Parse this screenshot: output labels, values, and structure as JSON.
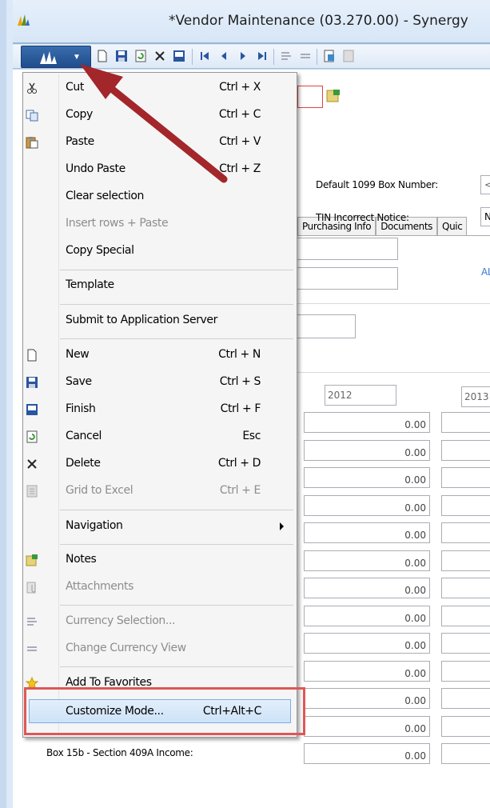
{
  "window": {
    "title": "*Vendor Maintenance (03.270.00) - Synergy"
  },
  "colors": {
    "menu_background": "#f5f5f5",
    "highlight": "#cde2f8",
    "annotation_red": "#de5757",
    "arrow": "#a3262a",
    "app_button": "#1f4c8c"
  },
  "toolbar": {
    "icons": [
      "app-menu-icon",
      "new-icon",
      "save-icon",
      "refresh-icon",
      "delete-icon",
      "finish-icon",
      "first-icon",
      "prev-icon",
      "next-icon",
      "last-icon",
      "currency-icon",
      "currency-view-icon",
      "notes-icon",
      "excel-icon"
    ]
  },
  "tabs": [
    "Purchasing Info",
    "Documents",
    "Quic"
  ],
  "form": {
    "default_1099_label": "Default 1099 Box Number:",
    "default_1099_value": "<N",
    "tin_label": "TIN Incorrect Notice:",
    "tin_value": "No",
    "all_link": "ALL",
    "year1": "2012",
    "year2": "2013",
    "amounts": [
      "0.00",
      "0.00",
      "0.00",
      "0.00",
      "0.00",
      "0.00",
      "0.00",
      "0.00",
      "0.00",
      "0.00",
      "0.00",
      "0.00",
      "0.00"
    ],
    "box15b_label": "Box 15b - Section 409A Income:"
  },
  "menu": {
    "items": [
      {
        "label": "Cut",
        "shortcut": "Ctrl + X",
        "icon": "scissors-icon",
        "enabled": true
      },
      {
        "label": "Copy",
        "shortcut": "Ctrl + C",
        "icon": "copy-icon",
        "enabled": true
      },
      {
        "label": "Paste",
        "shortcut": "Ctrl + V",
        "icon": "paste-icon",
        "enabled": true
      },
      {
        "label": "Undo Paste",
        "shortcut": "Ctrl + Z",
        "icon": "",
        "enabled": true
      },
      {
        "label": "Clear selection",
        "shortcut": "",
        "icon": "",
        "enabled": true
      },
      {
        "label": "Insert rows + Paste",
        "shortcut": "",
        "icon": "",
        "enabled": false
      },
      {
        "label": "Copy Special",
        "shortcut": "",
        "icon": "",
        "enabled": true
      },
      {
        "label": "Template",
        "shortcut": "",
        "icon": "",
        "enabled": true
      },
      {
        "label": "Submit to Application Server",
        "shortcut": "",
        "icon": "",
        "enabled": true
      },
      {
        "label": "New",
        "shortcut": "Ctrl + N",
        "icon": "new-document-icon",
        "enabled": true
      },
      {
        "label": "Save",
        "shortcut": "Ctrl + S",
        "icon": "save-icon",
        "enabled": true
      },
      {
        "label": "Finish",
        "shortcut": "Ctrl + F",
        "icon": "finish-icon",
        "enabled": true
      },
      {
        "label": "Cancel",
        "shortcut": "Esc",
        "icon": "cancel-refresh-icon",
        "enabled": true
      },
      {
        "label": "Delete",
        "shortcut": "Ctrl + D",
        "icon": "delete-x-icon",
        "enabled": true
      },
      {
        "label": "Grid to Excel",
        "shortcut": "Ctrl + E",
        "icon": "excel-icon",
        "enabled": false
      },
      {
        "label": "Navigation",
        "shortcut": "",
        "icon": "",
        "enabled": true,
        "submenu": true
      },
      {
        "label": "Notes",
        "shortcut": "",
        "icon": "notes-icon",
        "enabled": true
      },
      {
        "label": "Attachments",
        "shortcut": "",
        "icon": "attachments-icon",
        "enabled": false
      },
      {
        "label": "Currency Selection...",
        "shortcut": "",
        "icon": "currency-icon",
        "enabled": false
      },
      {
        "label": "Change Currency View",
        "shortcut": "",
        "icon": "currency-view-icon",
        "enabled": false
      },
      {
        "label": "Add To Favorites",
        "shortcut": "",
        "icon": "star-icon",
        "enabled": true
      },
      {
        "label": "Customize Mode...",
        "shortcut": "Ctrl+Alt+C",
        "icon": "",
        "enabled": true,
        "highlighted": true
      }
    ]
  }
}
